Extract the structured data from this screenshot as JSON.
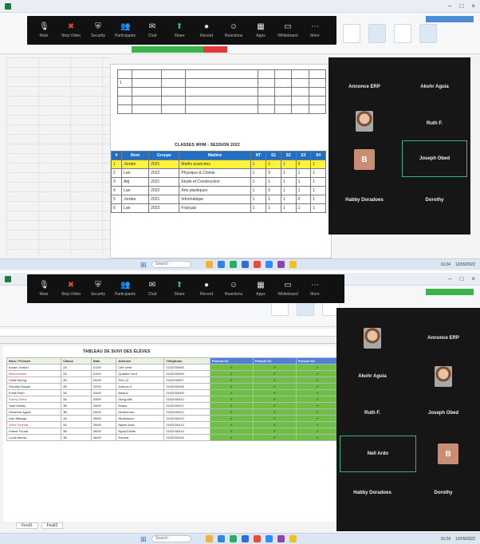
{
  "zoom_toolbar": {
    "buttons": [
      {
        "id": "mute",
        "icon": "microphone-icon",
        "label": "Mute"
      },
      {
        "id": "video",
        "icon": "camera-off-icon",
        "label": "Stop Video"
      },
      {
        "id": "security",
        "icon": "shield-icon",
        "label": "Security"
      },
      {
        "id": "participants",
        "icon": "people-icon",
        "label": "Participants"
      },
      {
        "id": "chat",
        "icon": "chat-icon",
        "label": "Chat"
      },
      {
        "id": "share",
        "icon": "share-screen-icon",
        "label": "Share"
      },
      {
        "id": "record",
        "icon": "record-icon",
        "label": "Record"
      },
      {
        "id": "reactions",
        "icon": "smile-icon",
        "label": "Reactions"
      },
      {
        "id": "apps",
        "icon": "apps-icon",
        "label": "Apps"
      },
      {
        "id": "whiteboard",
        "icon": "whiteboard-icon",
        "label": "Whiteboard"
      },
      {
        "id": "more",
        "icon": "more-icon",
        "label": "More"
      }
    ]
  },
  "top": {
    "doc_caption": "CLASSES WHM - SESSION 2022",
    "doc_header_cells": [
      "#",
      "Nom",
      "Groupe",
      "Matière",
      "NT",
      "S1",
      "S2",
      "S3",
      "S4"
    ],
    "doc_rows": [
      [
        "1",
        "Jordan",
        "2021",
        "Maths avancées",
        "1",
        "1",
        "1",
        "0",
        "1"
      ],
      [
        "2",
        "Lan",
        "2022",
        "Physique & Chimie",
        "1",
        "0",
        "1",
        "1",
        "1"
      ],
      [
        "3",
        "Adj",
        "2021",
        "Étude et Construction",
        "1",
        "1",
        "1",
        "1",
        "1"
      ],
      [
        "4",
        "Lan",
        "2022",
        "Arts plastiques",
        "1",
        "0",
        "1",
        "1",
        "1"
      ],
      [
        "5",
        "Jordan",
        "2021",
        "Informatique",
        "1",
        "1",
        "1",
        "0",
        "1"
      ],
      [
        "6",
        "Lan",
        "2023",
        "Français",
        "1",
        "1",
        "1",
        "1",
        "1"
      ]
    ],
    "participants": [
      {
        "name": "Annonce ERP",
        "sub": ""
      },
      {
        "name": "Akohr Aguia",
        "sub": ""
      },
      {
        "name": "Ruth F.",
        "sub": ""
      },
      {
        "name": "Joseph Obed",
        "sub": ""
      },
      {
        "name": "Habby Doradoes",
        "sub": ""
      },
      {
        "name": "Dorothy",
        "sub": ""
      }
    ],
    "letter_avatar": "B"
  },
  "bottom": {
    "sheet_title": "TABLEAU DE SUIVI DES ÉLÈVES",
    "col_headers": [
      "Nom / Prénom",
      "Classe",
      "Date",
      "Adresse",
      "Téléphone",
      "Présent S1",
      "Présent S2",
      "Présent S3"
    ],
    "rows": [
      [
        "Amani Jordan",
        "2A",
        "01/09",
        "Cité verte",
        "0102030405",
        "✓",
        "✓",
        "✓"
      ],
      [
        "Bela Kwame",
        "2A",
        "01/09",
        "Quartier nord",
        "0102030406",
        "✓",
        "✓",
        "✓"
      ],
      [
        "Celia Ndong",
        "2B",
        "02/09",
        "Rue 12",
        "0102030407",
        "✓",
        "✓",
        "✓"
      ],
      [
        "Dorothy Essam",
        "2B",
        "02/09",
        "Avenue 4",
        "0102030408",
        "✓",
        "✓",
        "✓"
      ],
      [
        "Emile Ruth",
        "3A",
        "03/09",
        "Bastos",
        "0102030409",
        "✓",
        "✓",
        "✓"
      ],
      [
        "Fanny Obed",
        "3A",
        "03/09",
        "Mvog-Mbi",
        "0102030410",
        "✓",
        "✓",
        "✓"
      ],
      [
        "Gael Habby",
        "3B",
        "04/09",
        "Essos",
        "0102030411",
        "✓",
        "✓",
        "✓"
      ],
      [
        "Hortense Aguia",
        "3B",
        "04/09",
        "Mimboman",
        "0102030412",
        "✓",
        "✓",
        "✓"
      ],
      [
        "Ivan Mbarga",
        "4A",
        "05/09",
        "Nkolbisson",
        "0102030413",
        "✓",
        "✓",
        "✓"
      ],
      [
        "Jules Tchinda",
        "4A",
        "05/09",
        "Biyem-Assi",
        "0102030414",
        "✓",
        "✓",
        "✓"
      ],
      [
        "Karine Fouda",
        "4B",
        "06/09",
        "Ngoa-Ekelle",
        "0102030415",
        "✓",
        "✓",
        "✓"
      ],
      [
        "Louis Abena",
        "4B",
        "06/09",
        "Emana",
        "0102030416",
        "✓",
        "✓",
        "✓"
      ]
    ],
    "sheet_tabs": [
      "Feuil1",
      "Feuil2"
    ],
    "participants": [
      {
        "name": "Annonce ERP",
        "sub": ""
      },
      {
        "name": "Akohr Aguia",
        "sub": ""
      },
      {
        "name": "Ruth F.",
        "sub": ""
      },
      {
        "name": "Joseph Obed",
        "sub": ""
      },
      {
        "name": "Nell Ardo",
        "sub": ""
      },
      {
        "name": "Habby Doradoes",
        "sub": ""
      },
      {
        "name": "Dorothy",
        "sub": ""
      }
    ],
    "letter_avatar": "B"
  },
  "taskbar": {
    "search_placeholder": "Search",
    "time": "10:24",
    "date": "12/09/2022"
  },
  "colors": {
    "zoom_bg": "#111111",
    "doc_header_blue": "#1f6fc4",
    "highlight_yellow": "#fff23a",
    "excel_green": "#70bf45",
    "share_green": "#3bb54a",
    "stop_red": "#e23a3a"
  }
}
